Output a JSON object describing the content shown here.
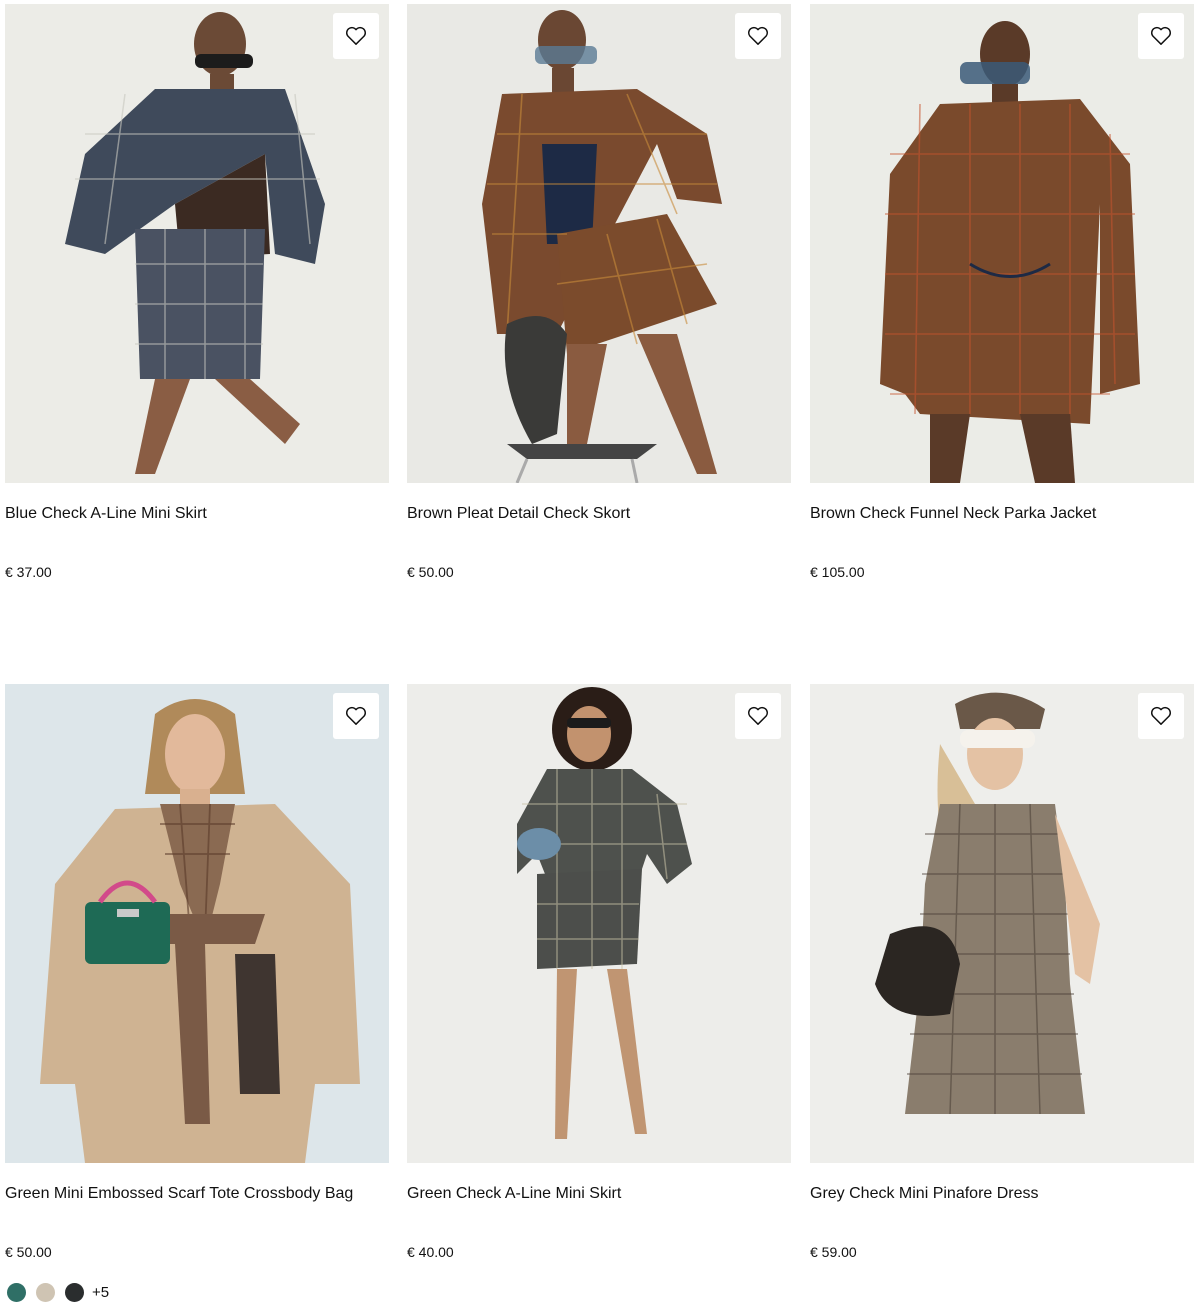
{
  "products": [
    {
      "name": "Blue Check A-Line Mini Skirt",
      "price": "€ 37.00",
      "bg": "#ecece7"
    },
    {
      "name": "Brown Pleat Detail Check Skort",
      "price": "€ 50.00",
      "bg": "#e9e9e5"
    },
    {
      "name": "Brown Check Funnel Neck Parka Jacket",
      "price": "€ 105.00",
      "bg": "#ebece7"
    },
    {
      "name": "Green Mini Embossed Scarf Tote Crossbody Bag",
      "price": "€ 50.00",
      "bg": "#dde6ea",
      "swatches": [
        "#2f6f66",
        "#cfc4b3",
        "#2a2d2e"
      ],
      "more_colors": "+5"
    },
    {
      "name": "Green Check A-Line Mini Skirt",
      "price": "€ 40.00",
      "bg": "#ededea"
    },
    {
      "name": "Grey Check Mini Pinafore Dress",
      "price": "€ 59.00",
      "bg": "#eeeeeb"
    }
  ],
  "icons": {
    "wishlist": "heart-outline-icon"
  }
}
